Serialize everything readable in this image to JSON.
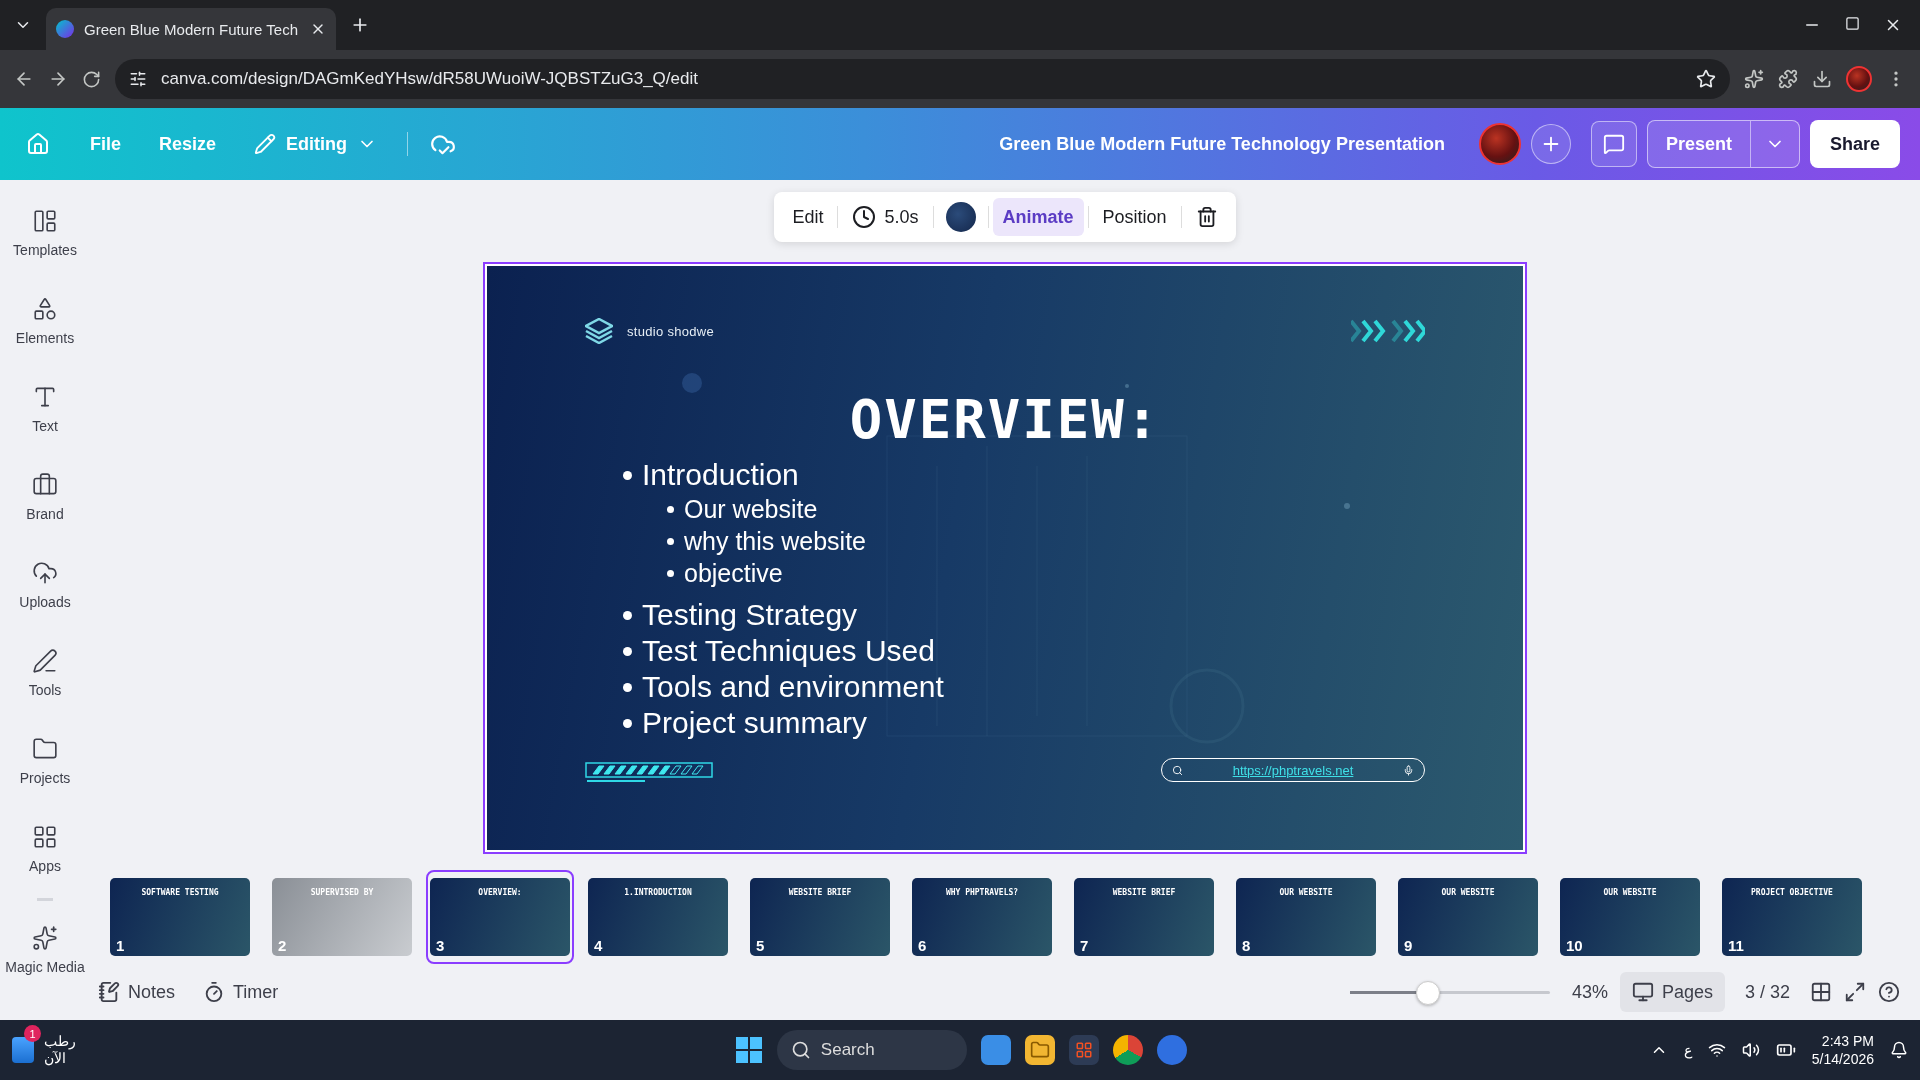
{
  "browser": {
    "tabs": [
      {
        "title": "Green Blue Modern Future Tech",
        "selected": true
      }
    ],
    "url": "canva.com/design/DAGmKedYHsw/dR58UWuoiW-JQBSTZuG3_Q/edit"
  },
  "header": {
    "menu": [
      "File",
      "Resize"
    ],
    "mode": "Editing",
    "title": "Green Blue Modern Future Technology Presentation",
    "present": "Present",
    "share": "Share"
  },
  "sidebar": {
    "items": [
      {
        "label": "Templates",
        "kind": "templates"
      },
      {
        "label": "Elements",
        "kind": "elements"
      },
      {
        "label": "Text",
        "kind": "text"
      },
      {
        "label": "Brand",
        "kind": "brand"
      },
      {
        "label": "Uploads",
        "kind": "uploads"
      },
      {
        "label": "Tools",
        "kind": "tools"
      },
      {
        "label": "Projects",
        "kind": "projects"
      },
      {
        "label": "Apps",
        "kind": "apps"
      },
      {
        "label": "Magic Media",
        "kind": "magic"
      }
    ]
  },
  "toolbar": {
    "edit": "Edit",
    "duration": "5.0s",
    "animate": "Animate",
    "position": "Position"
  },
  "slide": {
    "brand": "studio shodwe",
    "title": "OVERVIEW:",
    "bullets": [
      {
        "text": "Introduction",
        "children": [
          {
            "text": "Our website"
          },
          {
            "text": "why this website"
          },
          {
            "text": "objective"
          }
        ]
      },
      {
        "text": "Testing Strategy"
      },
      {
        "text": "Test Techniques Used"
      },
      {
        "text": "Tools and environment"
      },
      {
        "text": "Project summary"
      }
    ],
    "link": "https://phptravels.net"
  },
  "thumbnails": [
    {
      "number": "1",
      "title": "SOFTWARE TESTING",
      "selected": false
    },
    {
      "number": "2",
      "title": "SUPERVISED BY",
      "selected": false
    },
    {
      "number": "3",
      "title": "OVERVIEW:",
      "selected": true
    },
    {
      "number": "4",
      "title": "1.INTRODUCTION",
      "selected": false
    },
    {
      "number": "5",
      "title": "WEBSITE BRIEF",
      "selected": false
    },
    {
      "number": "6",
      "title": "WHY PHPTRAVELS?",
      "selected": false
    },
    {
      "number": "7",
      "title": "WEBSITE BRIEF",
      "selected": false
    },
    {
      "number": "8",
      "title": "OUR WEBSITE",
      "selected": false
    },
    {
      "number": "9",
      "title": "OUR WEBSITE",
      "selected": false
    },
    {
      "number": "10",
      "title": "OUR WEBSITE",
      "selected": false
    },
    {
      "number": "11",
      "title": "PROJECT OBJECTIVE",
      "selected": false
    }
  ],
  "footer": {
    "notes": "Notes",
    "timer": "Timer",
    "zoom": {
      "level": 0.39,
      "reading": "43%"
    },
    "pages": "Pages",
    "page_count": "3 / 32"
  },
  "taskbar": {
    "weather": "رطب",
    "weather_time": "الآن",
    "badge": "1",
    "search": "Search",
    "input_lang": "ع",
    "time": "2:43 PM",
    "date": "5/14/2026"
  }
}
